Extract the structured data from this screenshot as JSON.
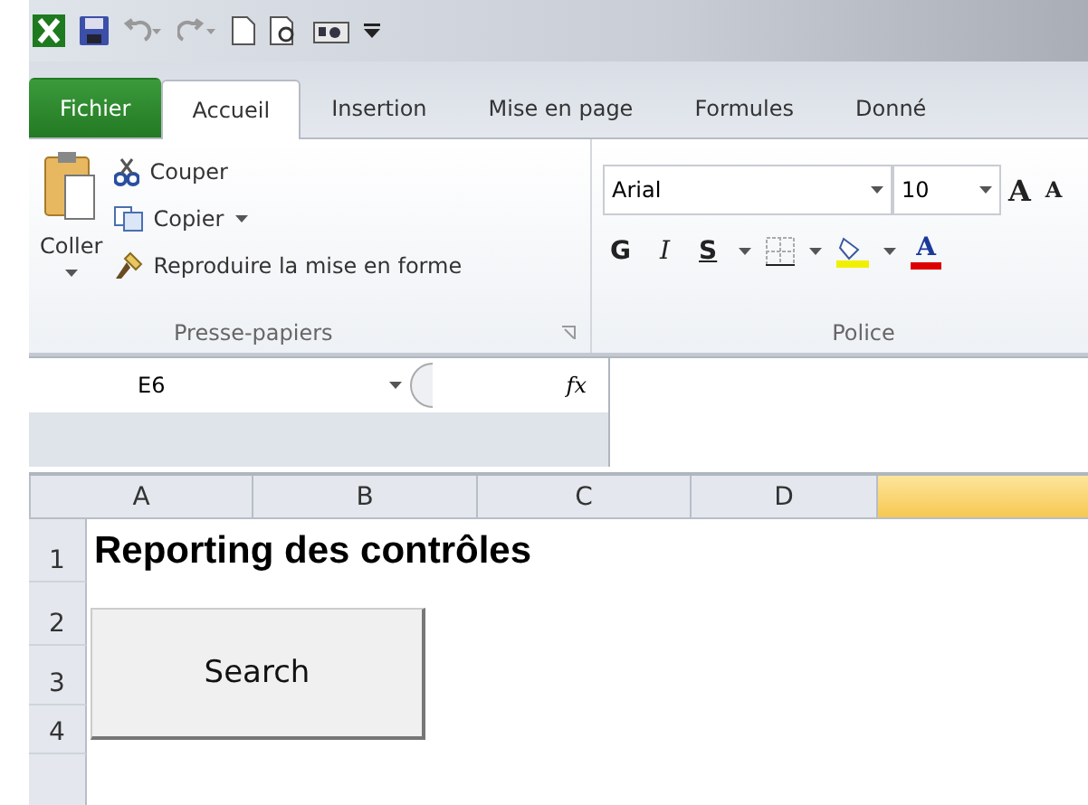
{
  "tabs": [
    {
      "label": "Fichier",
      "kind": "file",
      "selected": false
    },
    {
      "label": "Accueil",
      "kind": "tab",
      "selected": true
    },
    {
      "label": "Insertion",
      "kind": "tab",
      "selected": false
    },
    {
      "label": "Mise en page",
      "kind": "tab",
      "selected": false
    },
    {
      "label": "Formules",
      "kind": "tab",
      "selected": false
    },
    {
      "label": "Donné",
      "kind": "tab",
      "selected": false
    }
  ],
  "clipboard_group": {
    "paste": "Coller",
    "cut": "Couper",
    "copy": "Copier",
    "format_painter": "Reproduire la mise en forme",
    "label": "Presse-papiers"
  },
  "font_group": {
    "font": "Arial",
    "size": "10",
    "grow": "A",
    "shrink": "A",
    "bold": "G",
    "italic": "I",
    "underline": "S",
    "font_color": "A",
    "label": "Police"
  },
  "name_box": "E6",
  "formula_label": "fx",
  "columns": [
    {
      "label": "A",
      "selected": false
    },
    {
      "label": "B",
      "selected": false
    },
    {
      "label": "C",
      "selected": false
    },
    {
      "label": "D",
      "selected": false
    },
    {
      "selected": true
    }
  ],
  "rows": [
    {
      "number": "1",
      "cell": "Reporting des contrôles"
    },
    {
      "number": "2"
    },
    {
      "number": "3"
    },
    {
      "number": "4"
    },
    {}
  ],
  "search_button": "Search"
}
